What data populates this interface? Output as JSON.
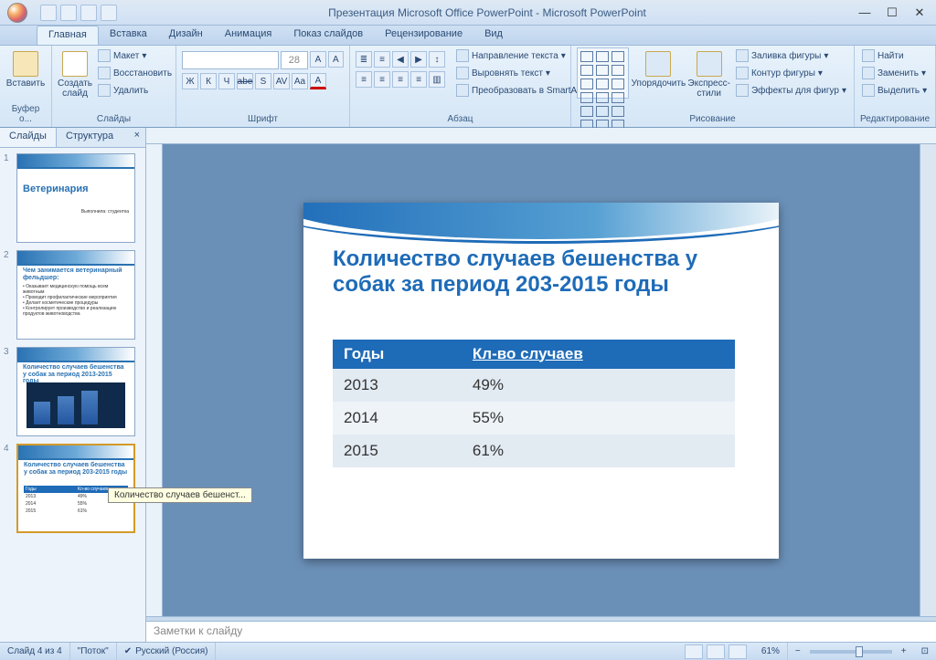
{
  "window": {
    "title": "Презентация Microsoft Office PowerPoint - Microsoft PowerPoint"
  },
  "ribbon": {
    "tabs": [
      "Главная",
      "Вставка",
      "Дизайн",
      "Анимация",
      "Показ слайдов",
      "Рецензирование",
      "Вид"
    ],
    "active_tab": 0,
    "groups": {
      "clipboard": {
        "label": "Буфер о...",
        "paste": "Вставить"
      },
      "slides": {
        "label": "Слайды",
        "new_slide": "Создать слайд",
        "layout": "Макет",
        "reset": "Восстановить",
        "delete": "Удалить"
      },
      "font": {
        "label": "Шрифт",
        "size": "28",
        "bold": "Ж",
        "italic": "К",
        "underline": "Ч",
        "strike": "abe",
        "shadow": "S",
        "spacing": "AV",
        "case": "Aa",
        "color": "A"
      },
      "paragraph": {
        "label": "Абзац",
        "text_dir": "Направление текста",
        "align_text": "Выровнять текст",
        "smartart": "Преобразовать в SmartArt"
      },
      "drawing": {
        "label": "Рисование",
        "arrange": "Упорядочить",
        "quick_styles": "Экспресс-стили",
        "shape_fill": "Заливка фигуры",
        "shape_outline": "Контур фигуры",
        "shape_effects": "Эффекты для фигур"
      },
      "editing": {
        "label": "Редактирование",
        "find": "Найти",
        "replace": "Заменить",
        "select": "Выделить"
      }
    }
  },
  "outline": {
    "tabs": {
      "slides": "Слайды",
      "structure": "Структура"
    },
    "thumbs": [
      {
        "title": "Ветеринария",
        "sub": "Выполнила: студентка"
      },
      {
        "title": "Чем занимается ветеринарный фельдшер:",
        "body": "• Оказывает медицинскую помощь всем животным\n• Проводит профилактические мероприятия\n• Делает косметические процедуры\n• Контролирует производство и реализацию продуктов животноводства"
      },
      {
        "title": "Количество случаев бешенства у собак за период 2013-2015 годы",
        "chart": true
      },
      {
        "title": "Количество случаев бешенства у собак за период 203-2015 годы",
        "table": true
      }
    ],
    "tooltip": "Количество случаев бешенст..."
  },
  "slide": {
    "title": "Количество случаев бешенства у собак за период 203-2015 годы",
    "table": {
      "headers": [
        "Годы",
        "Кл-во случаев"
      ],
      "rows": [
        [
          "2013",
          "49%"
        ],
        [
          "2014",
          "55%"
        ],
        [
          "2015",
          "61%"
        ]
      ]
    }
  },
  "notes": {
    "placeholder": "Заметки к слайду"
  },
  "status": {
    "slide_pos": "Слайд 4 из 4",
    "theme": "\"Поток\"",
    "lang": "Русский (Россия)",
    "zoom": "61%"
  },
  "chart_data": {
    "type": "table",
    "title": "Количество случаев бешенства у собак за период 203-2015 годы",
    "categories": [
      "2013",
      "2014",
      "2015"
    ],
    "values": [
      49,
      55,
      61
    ],
    "xlabel": "Годы",
    "ylabel": "Кл-во случаев"
  }
}
